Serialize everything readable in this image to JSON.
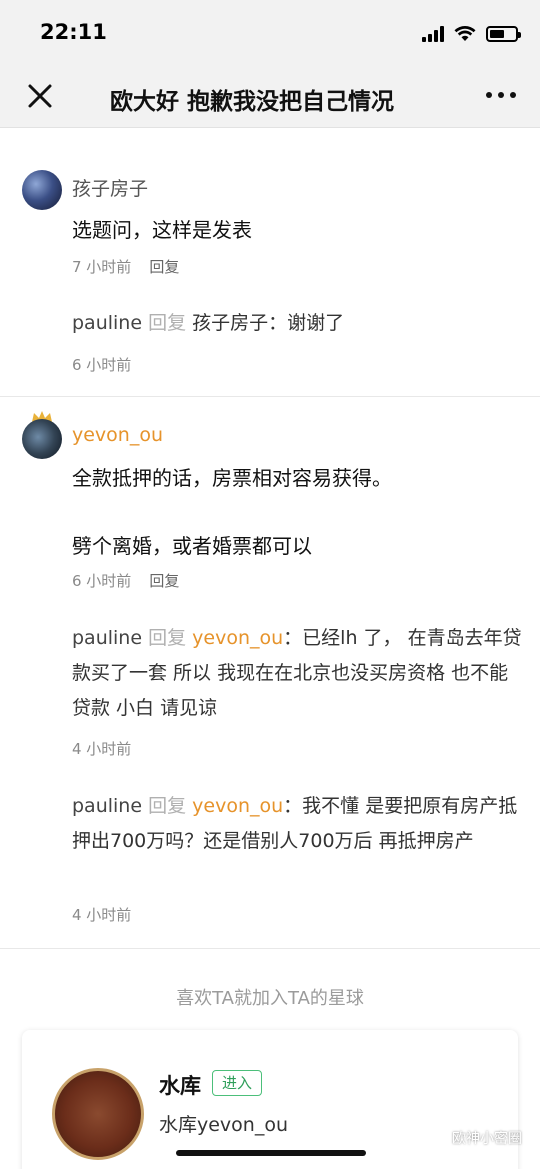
{
  "status_bar": {
    "time": "22:11"
  },
  "nav": {
    "title": "欧大好 抱歉我没把自己情况"
  },
  "comments": [
    {
      "username": "孩子房子",
      "text_lines": [
        "选题问，这样是发表"
      ],
      "time": "7 小时前",
      "reply_label": "回复",
      "replies": [
        {
          "name": "pauline",
          "verb": "回复",
          "target": "孩子房子",
          "text": "：谢谢了",
          "time": "6 小时前"
        }
      ]
    },
    {
      "username": "yevon_ou",
      "text_lines": [
        "全款抵押的话，房票相对容易获得。",
        "劈个离婚，或者婚票都可以"
      ],
      "time": "6 小时前",
      "reply_label": "回复",
      "replies": [
        {
          "name": "pauline",
          "verb": "回复",
          "target": "yevon_ou",
          "text": "：已经lh 了，  在青岛去年贷款买了一套 所以 我现在在北京也没买房资格 也不能贷款 小白 请见谅",
          "time": "4 小时前"
        },
        {
          "name": "pauline",
          "verb": "回复",
          "target": "yevon_ou",
          "text": "：我不懂 是要把原有房产抵押出700万吗？还是借别人700万后 再抵押房产",
          "time": "4 小时前"
        }
      ]
    }
  ],
  "recommend": {
    "label": "喜欢TA就加入TA的星球",
    "planet_name": "水库",
    "enter_label": "进入",
    "owner": "水库yevon_ou"
  },
  "watermark": {
    "label": "欧神小密圈"
  },
  "colors": {
    "accent_orange": "#e6932b",
    "green": "#4cbf7a",
    "meta_gray": "#8a8a8a"
  }
}
